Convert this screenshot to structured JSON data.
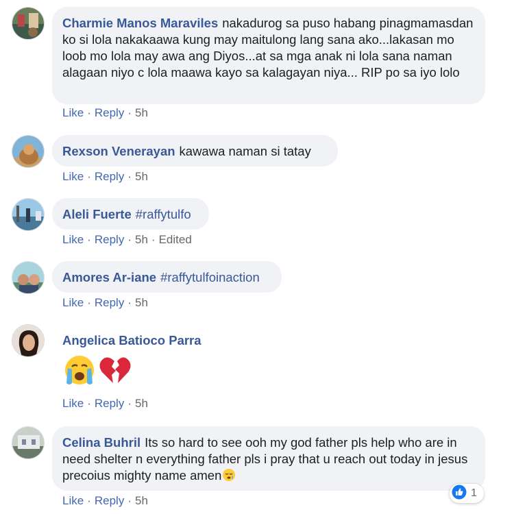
{
  "comments": [
    {
      "author": "Charmie Manos Maraviles",
      "text": "nakadurog sa puso habang pinagmamasdan ko si lola nakakaawa kung may maitulong lang sana ako...lakasan mo loob mo lola may awa ang Diyos...at sa mga anak ni lola sana naman alagaan niyo c lola maawa kayo sa kalagayan niya... RIP po sa iyo lolo",
      "like": "Like",
      "reply": "Reply",
      "time": "5h"
    },
    {
      "author": "Rexson Venerayan",
      "text": "kawawa naman si tatay",
      "like": "Like",
      "reply": "Reply",
      "time": "5h"
    },
    {
      "author": "Aleli Fuerte",
      "text": "#raffytulfo",
      "like": "Like",
      "reply": "Reply",
      "time": "5h",
      "edited": "Edited"
    },
    {
      "author": "Amores Ar-iane",
      "text": "#raffytulfoinaction",
      "like": "Like",
      "reply": "Reply",
      "time": "5h"
    },
    {
      "author": "Angelica Batioco Parra",
      "emojis": [
        "crying-face-emoji",
        "broken-heart-emoji"
      ],
      "like": "Like",
      "reply": "Reply",
      "time": "5h"
    },
    {
      "author": "Celina Buhril",
      "text": "Its so hard to see ooh my god father pls help who are in need shelter n everything father pls i pray that u reach out today in jesus precoius mighty name amen",
      "like": "Like",
      "reply": "Reply",
      "time": "5h",
      "reaction_icon": "like-thumb-icon",
      "reaction_count": "1"
    }
  ],
  "colors": {
    "link": "#385898",
    "action": "#4267b2",
    "muted": "#65676b",
    "bubble": "#f0f2f5",
    "like_blue": "#1877f2"
  }
}
